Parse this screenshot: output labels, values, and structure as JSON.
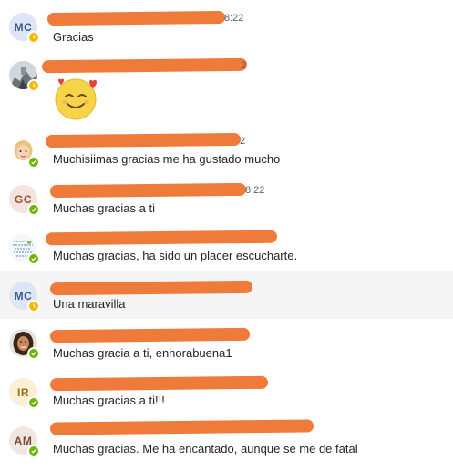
{
  "messages": [
    {
      "avatar_initials": "MC",
      "timestamp": "8:22",
      "text": "Gracias",
      "presence": "away"
    },
    {
      "avatar_initials": "",
      "timestamp": "2",
      "text": "",
      "emoji": "smiling-face-with-hearts",
      "presence": "away"
    },
    {
      "avatar_initials": "",
      "timestamp": "2",
      "text": "Muchisiimas gracias me ha gustado mucho",
      "presence": "online"
    },
    {
      "avatar_initials": "GC",
      "timestamp": "8:22",
      "text": "Muchas gracias a ti",
      "presence": "online"
    },
    {
      "avatar_initials": "",
      "timestamp": "",
      "text": "Muchas gracias, ha sido un placer escucharte.",
      "presence": "online"
    },
    {
      "avatar_initials": "MC",
      "timestamp": "",
      "text": "Una maravilla",
      "presence": "away"
    },
    {
      "avatar_initials": "",
      "timestamp": "",
      "text": "Muchas gracia a ti,  enhorabuena1",
      "presence": "online"
    },
    {
      "avatar_initials": "IR",
      "timestamp": "",
      "text": "Muchas gracias a ti!!!",
      "presence": "online"
    },
    {
      "avatar_initials": "AM",
      "timestamp": "",
      "text": "Muchas gracias. Me ha encantado, aunque se me de fatal",
      "presence": "online"
    }
  ],
  "colors": {
    "redaction": "#ef7b3a",
    "avatar_mc_bg": "#dce6f5",
    "avatar_gc_bg": "#f6e3de",
    "avatar_ir_bg": "#fbf0d6",
    "avatar_am_bg": "#f0e6e2",
    "away": "#f8b600",
    "online": "#6bb700"
  }
}
